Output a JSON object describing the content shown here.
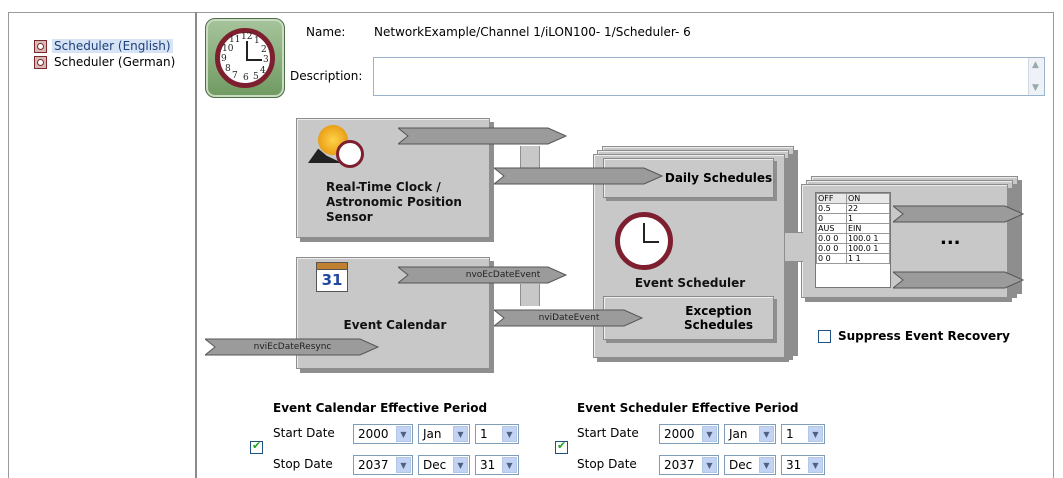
{
  "tree": {
    "items": [
      {
        "label": "Scheduler (English)",
        "selected": true
      },
      {
        "label": "Scheduler (German)",
        "selected": false
      }
    ]
  },
  "header": {
    "name_label": "Name:",
    "name_value": "NetworkExample/Channel 1/iLON100- 1/Scheduler- 6",
    "description_label": "Description:",
    "description_value": ""
  },
  "clock_numbers": [
    "12",
    "1",
    "2",
    "3",
    "4",
    "5",
    "6",
    "7",
    "8",
    "9",
    "10",
    "11"
  ],
  "diagram": {
    "rtc_title": "Real-Time Clock / Astronomic Position Sensor",
    "calendar_title": "Event Calendar",
    "scheduler_title": "Event Scheduler",
    "daily_button": "Daily Schedules",
    "exception_button": "Exception Schedules",
    "arrow_nvo": "nvoEcDateEvent",
    "arrow_nvi_date": "nviDateEvent",
    "arrow_nvi_resync": "nviEcDateResync",
    "ellipsis": "...",
    "calendar_icon_text": "31",
    "onoff_table": [
      [
        "OFF",
        "ON"
      ],
      [
        "0.5",
        "22"
      ],
      [
        "0",
        "1"
      ],
      [
        "AUS",
        "EIN"
      ],
      [
        "0.0 0",
        "100.0 1"
      ],
      [
        "0.0 0",
        "100.0 1"
      ],
      [
        "0 0",
        "1 1"
      ]
    ],
    "suppress_label": "Suppress Event Recovery",
    "suppress_checked": false
  },
  "calendar_period": {
    "title": "Event Calendar Effective Period",
    "checked": true,
    "start_label": "Start Date",
    "stop_label": "Stop Date",
    "start": {
      "year": "2000",
      "month": "Jan",
      "day": "1"
    },
    "stop": {
      "year": "2037",
      "month": "Dec",
      "day": "31"
    }
  },
  "scheduler_period": {
    "title": "Event Scheduler Effective Period",
    "checked": true,
    "start_label": "Start Date",
    "stop_label": "Stop Date",
    "start": {
      "year": "2000",
      "month": "Jan",
      "day": "1"
    },
    "stop": {
      "year": "2037",
      "month": "Dec",
      "day": "31"
    }
  },
  "icons": {
    "tree": "scheduler-icon",
    "header": "clock-icon",
    "dropdown": "chevron-down-icon",
    "checkbox": "checkmark-icon"
  }
}
